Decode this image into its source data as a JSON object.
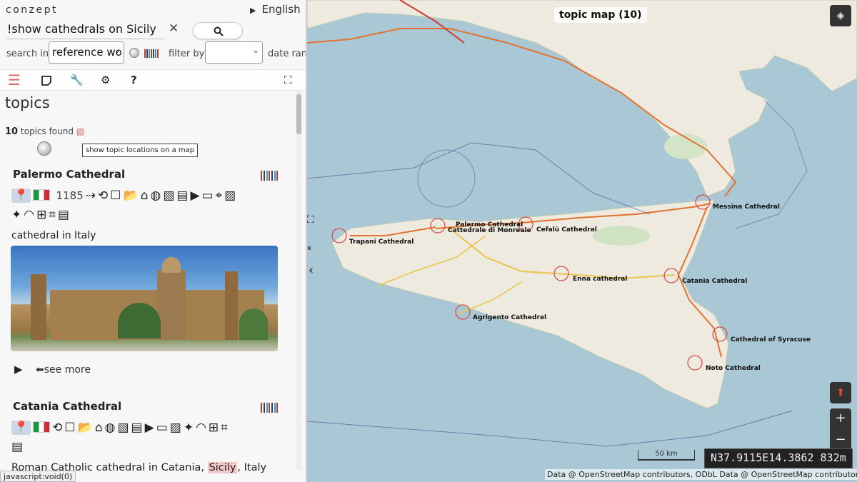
{
  "app": {
    "logo": "conzept",
    "language": "English"
  },
  "search": {
    "query": "!show cathedrals on Sicily",
    "clear_icon": "close-icon",
    "search_icon": "search-icon"
  },
  "filters": {
    "search_in_label": "search in:",
    "search_in_value": "reference wo",
    "filter_by_label": "filter by:",
    "filter_by_value": "",
    "date_range_label": "date rang"
  },
  "toolbar": [
    "menu-icon",
    "note-icon",
    "wrench-icon",
    "gear-icon",
    "help-icon",
    "fullscreen-icon"
  ],
  "topics": {
    "heading": "topics",
    "count": "10",
    "found_text": "topics found",
    "map_tooltip": "show topic locations on a map"
  },
  "cards": [
    {
      "title": "Palermo Cathedral",
      "year": "1185",
      "description": "cathedral in Italy",
      "see_more": "see more"
    },
    {
      "title": "Catania Cathedral",
      "description_prefix": "Roman Catholic cathedral in Catania, ",
      "description_highlight": "Sicily",
      "description_suffix": ", Italy"
    }
  ],
  "statusbar": "javascript:void(0)",
  "map": {
    "title": "topic map (10)",
    "coords": "N37.9115E14.3862 832m",
    "scale": "50 km",
    "attribution": "Data @ OpenStreetMap contributors, ODbL  Data @ OpenStreetMap contributors, ODbL",
    "markers": [
      "Palermo Cathedral",
      "Cattedrale di Monreale",
      "Cefalù Cathedral",
      "Trapani Cathedral",
      "Messina Cathedral",
      "Enna cathedral",
      "Catania Cathedral",
      "Agrigento Cathedral",
      "Cathedral of Syracuse",
      "Noto Cathedral"
    ]
  },
  "colors": {
    "accent": "#e06666",
    "sea": "#a9c7d4",
    "land": "#efeae0",
    "highway": "#e2722f"
  }
}
